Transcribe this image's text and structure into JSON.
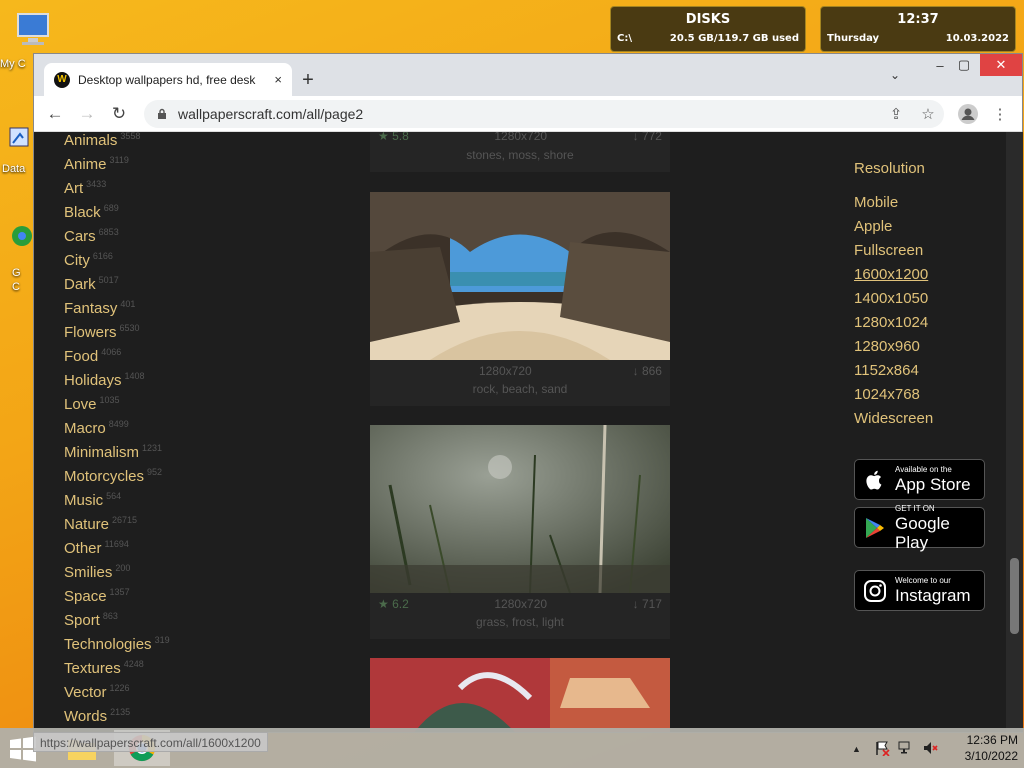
{
  "desktop": {
    "icons": [
      {
        "label": "My C"
      },
      {
        "label": "Data"
      },
      {
        "label": "G C"
      }
    ],
    "disks_widget": {
      "title": "DISKS",
      "drive": "C:\\",
      "usage": "20.5 GB/119.7 GB used"
    },
    "clock_widget": {
      "time": "12:37",
      "day": "Thursday",
      "date": "10.03.2022"
    }
  },
  "browser": {
    "tab": {
      "title": "Desktop wallpapers hd, free desk",
      "close": "×"
    },
    "new_tab": "+",
    "tab_list": "⌄",
    "window": {
      "minimize": "–",
      "maximize": "▢",
      "close": "✕"
    },
    "nav": {
      "back": "←",
      "forward": "→",
      "reload": "↻"
    },
    "address": "wallpaperscraft.com/all/page2",
    "toolbar": {
      "share": "⇪",
      "star": "☆",
      "menu": "⋮"
    }
  },
  "categories": [
    {
      "name": "Animals",
      "count": "3558"
    },
    {
      "name": "Anime",
      "count": "3119"
    },
    {
      "name": "Art",
      "count": "3433"
    },
    {
      "name": "Black",
      "count": "689"
    },
    {
      "name": "Cars",
      "count": "6853"
    },
    {
      "name": "City",
      "count": "6166"
    },
    {
      "name": "Dark",
      "count": "5017"
    },
    {
      "name": "Fantasy",
      "count": "401"
    },
    {
      "name": "Flowers",
      "count": "6530"
    },
    {
      "name": "Food",
      "count": "4066"
    },
    {
      "name": "Holidays",
      "count": "1408"
    },
    {
      "name": "Love",
      "count": "1035"
    },
    {
      "name": "Macro",
      "count": "8499"
    },
    {
      "name": "Minimalism",
      "count": "1231"
    },
    {
      "name": "Motorcycles",
      "count": "952"
    },
    {
      "name": "Music",
      "count": "564"
    },
    {
      "name": "Nature",
      "count": "26715"
    },
    {
      "name": "Other",
      "count": "11694"
    },
    {
      "name": "Smilies",
      "count": "200"
    },
    {
      "name": "Space",
      "count": "1357"
    },
    {
      "name": "Sport",
      "count": "863"
    },
    {
      "name": "Technologies",
      "count": "319"
    },
    {
      "name": "Textures",
      "count": "4248"
    },
    {
      "name": "Vector",
      "count": "1226"
    },
    {
      "name": "Words",
      "count": "2135"
    }
  ],
  "wallpapers": [
    {
      "rating": "★ 5.8",
      "resolution": "1280x720",
      "downloads": "↓ 772",
      "tags": "stones, moss, shore"
    },
    {
      "rating": "",
      "resolution": "1280x720",
      "downloads": "↓ 866",
      "tags": "rock, beach, sand"
    },
    {
      "rating": "★ 6.2",
      "resolution": "1280x720",
      "downloads": "↓ 717",
      "tags": "grass, frost, light"
    }
  ],
  "resolution_panel": {
    "title": "Resolution",
    "links": [
      "Mobile",
      "Apple",
      "Fullscreen",
      "1600x1200",
      "1400x1050",
      "1280x1024",
      "1280x960",
      "1152x864",
      "1024x768",
      "Widescreen"
    ]
  },
  "badges": {
    "appstore": {
      "small": "Available on the",
      "big": "App Store"
    },
    "googleplay": {
      "small": "GET IT ON",
      "big": "Google Play"
    },
    "instagram": {
      "small": "Welcome to our",
      "big": "Instagram"
    }
  },
  "status_url": "https://wallpaperscraft.com/all/1600x1200",
  "taskbar": {
    "time": "12:36 PM",
    "date": "3/10/2022",
    "tray_up": "▲"
  },
  "colors": {
    "accent_link": "#e0c27a",
    "page_bg": "#1e1e1e"
  }
}
